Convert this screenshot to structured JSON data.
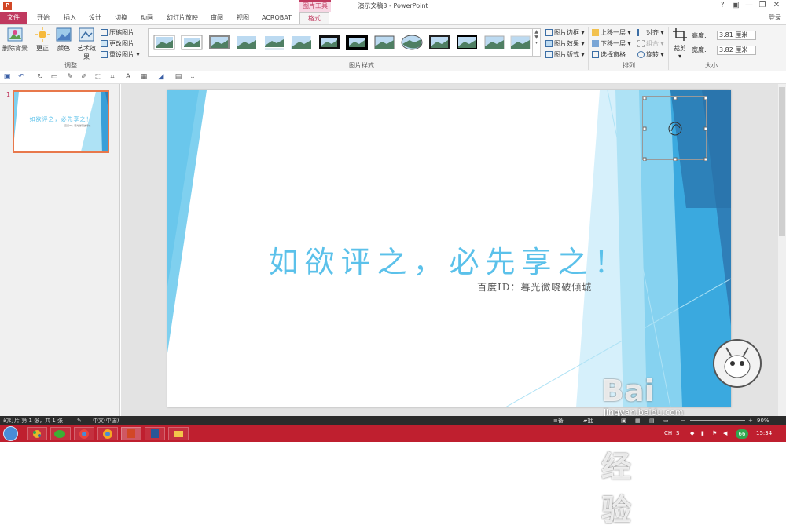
{
  "window": {
    "title": "演示文稿3 - PowerPoint",
    "contextual_tab_group": "图片工具",
    "login": "登录",
    "controls": [
      "?",
      "▣",
      "—",
      "❐",
      "✕"
    ]
  },
  "tabs": [
    {
      "label": "文件"
    },
    {
      "label": "开始"
    },
    {
      "label": "插入"
    },
    {
      "label": "设计"
    },
    {
      "label": "切换"
    },
    {
      "label": "动画"
    },
    {
      "label": "幻灯片放映"
    },
    {
      "label": "审阅"
    },
    {
      "label": "视图"
    },
    {
      "label": "ACROBAT"
    },
    {
      "label": "格式"
    }
  ],
  "ribbon": {
    "remove_bg": "删除背景",
    "corrections": "更正",
    "color": "颜色",
    "artistic": "艺术效果",
    "compress": "压缩图片",
    "change": "更改图片",
    "reset": "重设图片",
    "adjust_group": "调整",
    "picture_styles_group": "图片样式",
    "border": "图片边框",
    "effects": "图片效果",
    "layout": "图片版式",
    "bring_forward": "上移一层",
    "send_backward": "下移一层",
    "selection_pane": "选择窗格",
    "align": "对齐",
    "group": "组合",
    "rotate": "旋转",
    "arrange_group": "排列",
    "crop": "裁剪",
    "height_label": "高度:",
    "height_value": "3.81 厘米",
    "width_label": "宽度:",
    "width_value": "3.82 厘米",
    "size_group": "大小"
  },
  "thumbnail": {
    "number": "1",
    "title": "如欲评之，必先享之！",
    "sub": "百度ID：暮光微晓破倾城"
  },
  "slide": {
    "title": "如欲评之，必先享之！",
    "subtitle": "百度ID：暮光微晓破倾城"
  },
  "statusbar": {
    "slide_info": "幻灯片 第 1 张，共 1 张",
    "language": "中文(中国)",
    "notes": "备注",
    "comments": "批注",
    "zoom": "90%"
  },
  "taskbar": {
    "ime": "CH",
    "badge": "66",
    "time": "15:34"
  },
  "watermark": {
    "brand": "Bai du 经验",
    "url": "jingyan.baidu.com"
  },
  "colors": {
    "accent": "#c0395f",
    "slide_blue": "#5bc1ea",
    "deep_blue": "#2f7fb8",
    "taskbar": "#bf1f2f"
  }
}
